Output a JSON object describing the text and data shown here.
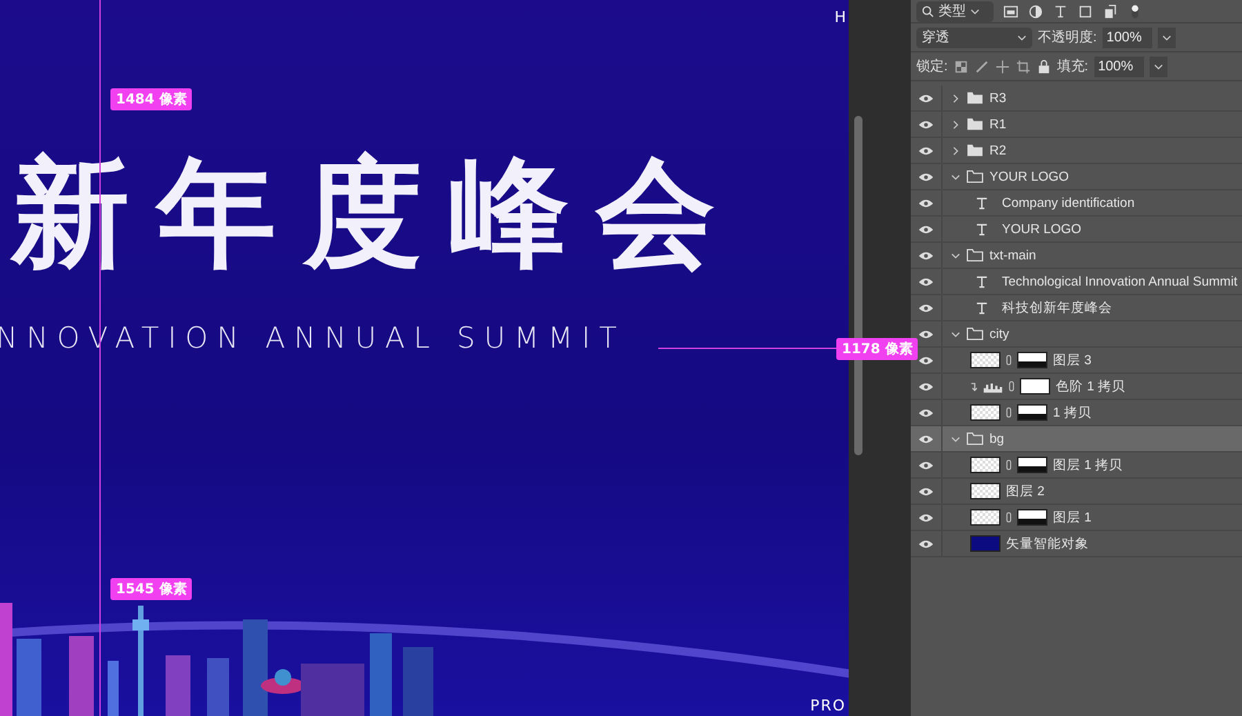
{
  "canvas": {
    "title": "新年度峰会",
    "subtitle": "NNOVATION ANNUAL SUMMIT",
    "corner_top": "H",
    "corner_bottom": "PRO",
    "measures": [
      {
        "label": "1484 像素",
        "kind": "vertical-top"
      },
      {
        "label": "1545 像素",
        "kind": "vertical-bottom"
      },
      {
        "label": "1178 像素",
        "kind": "horizontal"
      }
    ]
  },
  "toolbar": {
    "filter": "类型",
    "blend_mode": "穿透",
    "opacity_label": "不透明度:",
    "opacity": "100%",
    "lock_label": "锁定:",
    "fill_label": "填充:",
    "fill": "100%"
  },
  "layers": [
    {
      "name": "R3",
      "kind": "folder",
      "visible": true,
      "expanded": false,
      "selected": false
    },
    {
      "name": "R1",
      "kind": "folder",
      "visible": true,
      "expanded": false,
      "selected": false
    },
    {
      "name": "R2",
      "kind": "folder",
      "visible": true,
      "expanded": false,
      "selected": false
    },
    {
      "name": "YOUR LOGO",
      "kind": "folder",
      "visible": true,
      "expanded": true,
      "selected": false,
      "children": [
        {
          "name": "Company identification",
          "kind": "text",
          "visible": true,
          "selected": false
        },
        {
          "name": "YOUR LOGO",
          "kind": "text",
          "visible": true,
          "selected": false
        }
      ]
    },
    {
      "name": "txt-main",
      "kind": "folder",
      "visible": true,
      "expanded": true,
      "selected": false,
      "children": [
        {
          "name": "Technological Innovation Annual Summit",
          "kind": "text",
          "visible": true,
          "selected": false
        },
        {
          "name": "科技创新年度峰会",
          "kind": "text",
          "visible": true,
          "selected": false
        }
      ]
    },
    {
      "name": "city",
      "kind": "folder",
      "visible": true,
      "expanded": true,
      "selected": false,
      "children": [
        {
          "name": "图层 3",
          "kind": "image",
          "visible": true,
          "selected": false
        },
        {
          "name": "色阶 1 拷贝",
          "kind": "adjustment",
          "visible": true,
          "selected": false
        },
        {
          "name": "1 拷贝",
          "kind": "image",
          "visible": true,
          "selected": false
        }
      ]
    },
    {
      "name": "bg",
      "kind": "folder",
      "visible": true,
      "expanded": true,
      "selected": true,
      "children": [
        {
          "name": "图层 1 拷贝",
          "kind": "image",
          "visible": true,
          "selected": false
        },
        {
          "name": "图层 2",
          "kind": "plain",
          "visible": true,
          "selected": false
        },
        {
          "name": "图层 1",
          "kind": "image",
          "visible": true,
          "selected": false
        },
        {
          "name": "矢量智能对象",
          "kind": "smart",
          "visible": true,
          "selected": false
        }
      ]
    }
  ]
}
